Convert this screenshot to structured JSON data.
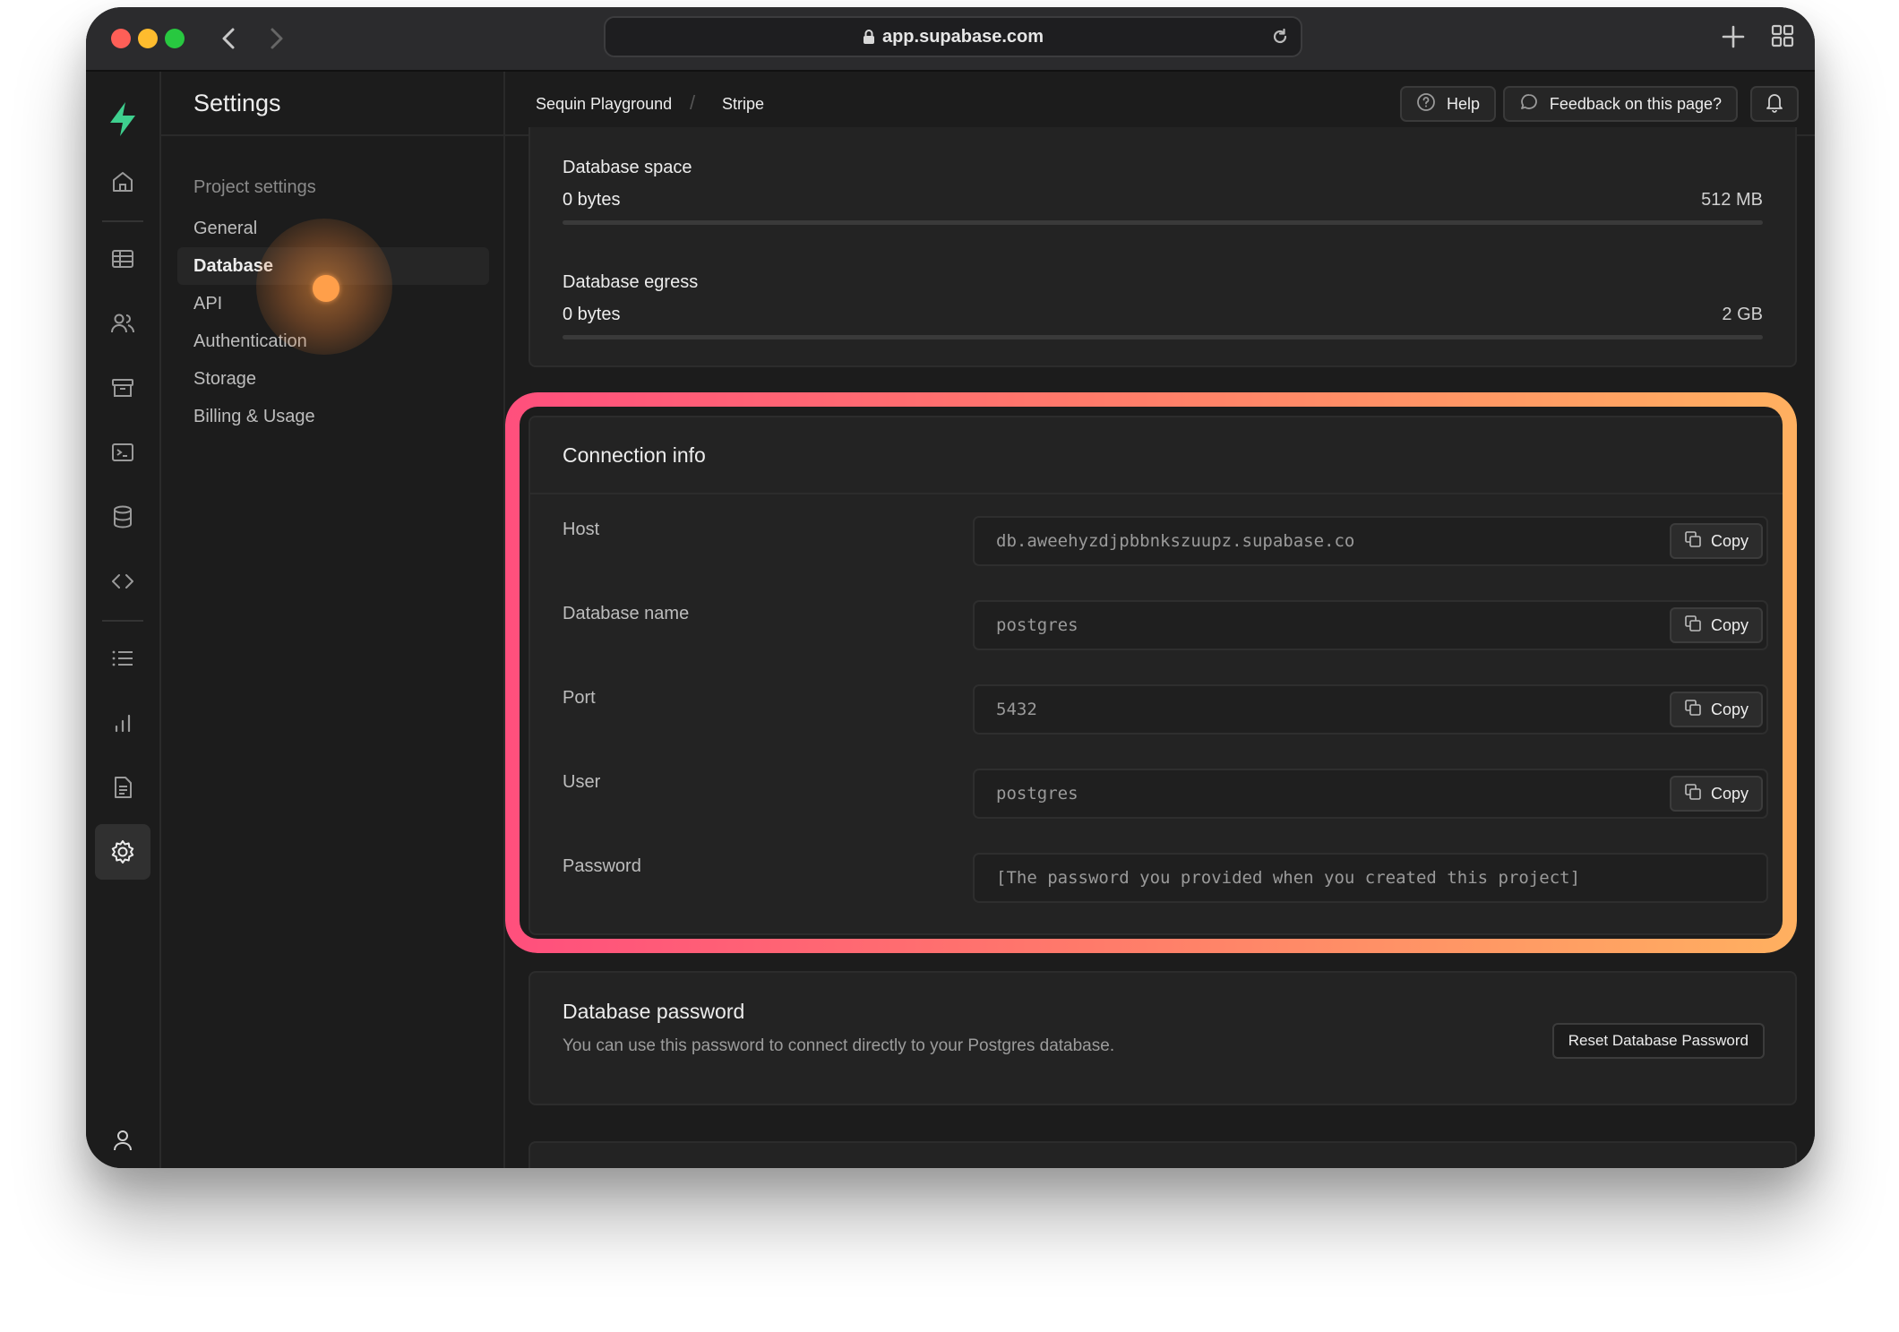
{
  "browser": {
    "url": "app.supabase.com"
  },
  "rail": {
    "items": [
      "home-icon",
      "table-icon",
      "users-icon",
      "archive-icon",
      "terminal-icon",
      "database-icon",
      "code-icon",
      "list-icon",
      "chart-icon",
      "document-icon",
      "gear-icon"
    ],
    "active": "gear-icon",
    "footer": "user-icon"
  },
  "sidebar": {
    "title": "Settings",
    "section": "Project settings",
    "items": [
      {
        "label": "General"
      },
      {
        "label": "Database"
      },
      {
        "label": "API"
      },
      {
        "label": "Authentication"
      },
      {
        "label": "Storage"
      },
      {
        "label": "Billing & Usage"
      }
    ],
    "active_item": "Database"
  },
  "header": {
    "breadcrumbs": [
      "Sequin Playground",
      "Stripe"
    ],
    "help_label": "Help",
    "feedback_label": "Feedback on this page?"
  },
  "usage": [
    {
      "label": "Database space",
      "value": "0 bytes",
      "max": "512 MB",
      "fraction": 0
    },
    {
      "label": "Database egress",
      "value": "0 bytes",
      "max": "2 GB",
      "fraction": 0
    }
  ],
  "connection": {
    "title": "Connection info",
    "copy_label": "Copy",
    "fields": [
      {
        "label": "Host",
        "value": "db.aweehyzdjpbbnkszuupz.supabase.co"
      },
      {
        "label": "Database name",
        "value": "postgres"
      },
      {
        "label": "Port",
        "value": "5432"
      },
      {
        "label": "User",
        "value": "postgres"
      },
      {
        "label": "Password",
        "value": "[The password you provided when you created this project]"
      }
    ]
  },
  "password": {
    "title": "Database password",
    "description": "You can use this password to connect directly to your Postgres database.",
    "reset_label": "Reset Database Password"
  },
  "colors": {
    "brand": "#3ecf8e",
    "highlight_start": "#ff4f7d",
    "highlight_end": "#ffb060",
    "cursor": "#ff9f4a"
  }
}
